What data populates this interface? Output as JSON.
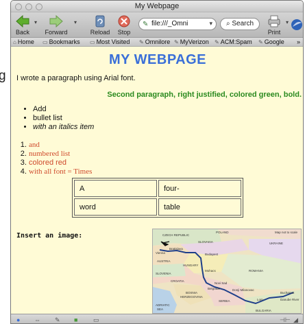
{
  "window": {
    "title": "My Webpage"
  },
  "toolbar": {
    "back_label": "Back",
    "forward_label": "Forward",
    "reload_label": "Reload",
    "stop_label": "Stop",
    "url_value": "file:///_Omni",
    "search_label": "Search",
    "print_label": "Print"
  },
  "bookmarks": {
    "items": [
      "Home",
      "Bookmarks",
      "Most Visited",
      "Omnilore",
      "MyVerizon",
      "ACM:Spam",
      "Google"
    ],
    "overflow": "»"
  },
  "page": {
    "heading": "MY WEBPAGE",
    "paragraph1": "I wrote a paragraph using Arial font.",
    "paragraph2": "Second paragraph, right justified, colored green, bold.",
    "bullets": [
      "Add",
      "bullet list",
      "with an italics item"
    ],
    "numbered": [
      "and",
      "numbered list",
      "colored red",
      "with all font = Times"
    ],
    "table": [
      [
        "A",
        "four-"
      ],
      [
        "word",
        "table"
      ]
    ],
    "insert_label": "Insert an image:"
  },
  "map": {
    "labels": {
      "czech": "CZECH REPUBLIC",
      "poland": "POLAND",
      "scale": "Map not to scale",
      "slovakia": "SLOVAKIA",
      "ukraine": "UKRAINE",
      "vienna": "Vienna",
      "bratislava": "Bratislava",
      "budapest": "Budapest",
      "austria": "AUSTRIA",
      "hungary": "HUNGARY",
      "mohacs": "Mohacs",
      "slovenia": "SLOVENIA",
      "croatia": "CROATIA",
      "romania": "ROMANIA",
      "novisad": "Novi Sad",
      "belgrade": "Belgrade",
      "dmilanovac": "Donji Milanovac",
      "bosnia": "BOSNIA",
      "herzegovina": "HERZEGOVINA",
      "serbia": "SERBIA",
      "bucharest": "Bucharest",
      "lom": "Lom",
      "danube": "Danube River",
      "adriatic": "ADRIATIC",
      "sea": "SEA",
      "bulgaria": "BULGARIA"
    }
  },
  "colors": {
    "heading": "#3a6fd8",
    "green": "#2a8a1f",
    "red": "#cf4a2c",
    "page_bg": "#fffbd6"
  },
  "stray_letter": "g"
}
